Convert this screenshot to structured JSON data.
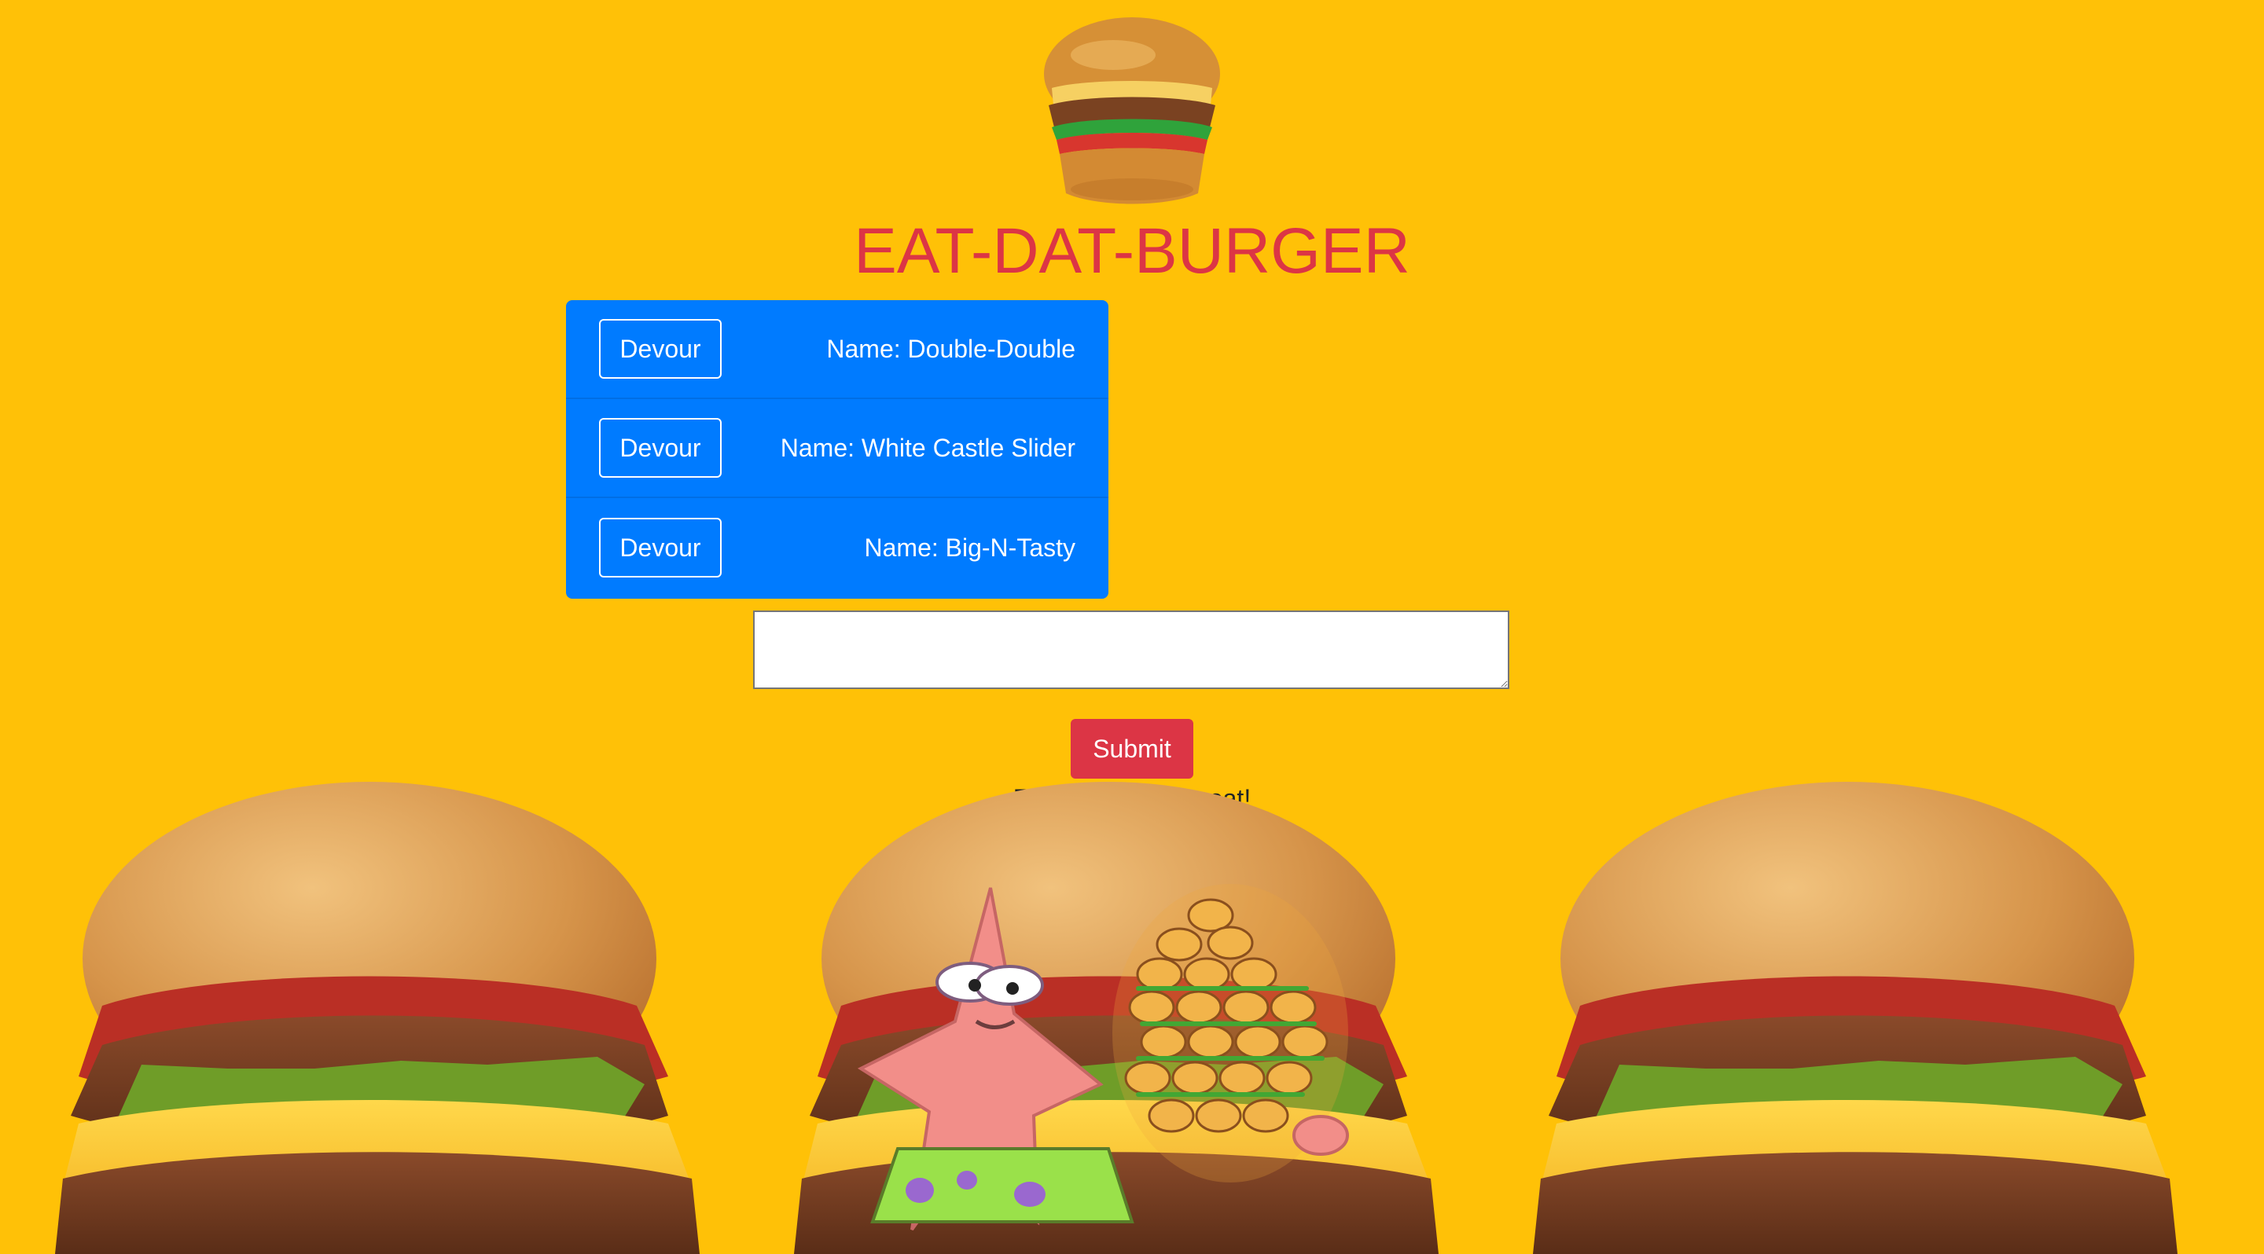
{
  "header": {
    "logo_icon": "burger-icon",
    "title": "EAT-DAT-BURGER"
  },
  "burgers": [
    {
      "button_label": "Devour",
      "name": "Name: Double-Double"
    },
    {
      "button_label": "Devour",
      "name": "Name: White Castle Slider"
    },
    {
      "button_label": "Devour",
      "name": "Name: Big-N-Tasty"
    }
  ],
  "form": {
    "input_value": "",
    "submit_label": "Submit",
    "helper_text": "Enter a burger to eat!"
  },
  "colors": {
    "background": "#ffc107",
    "title": "#dc3545",
    "list_background": "#007bff",
    "submit_background": "#dc3545"
  },
  "decorations": {
    "left_image": "cheeseburger-icon",
    "center_image": "cheeseburger-icon",
    "center_character": "patrick-star-icon",
    "right_image": "cheeseburger-icon"
  }
}
